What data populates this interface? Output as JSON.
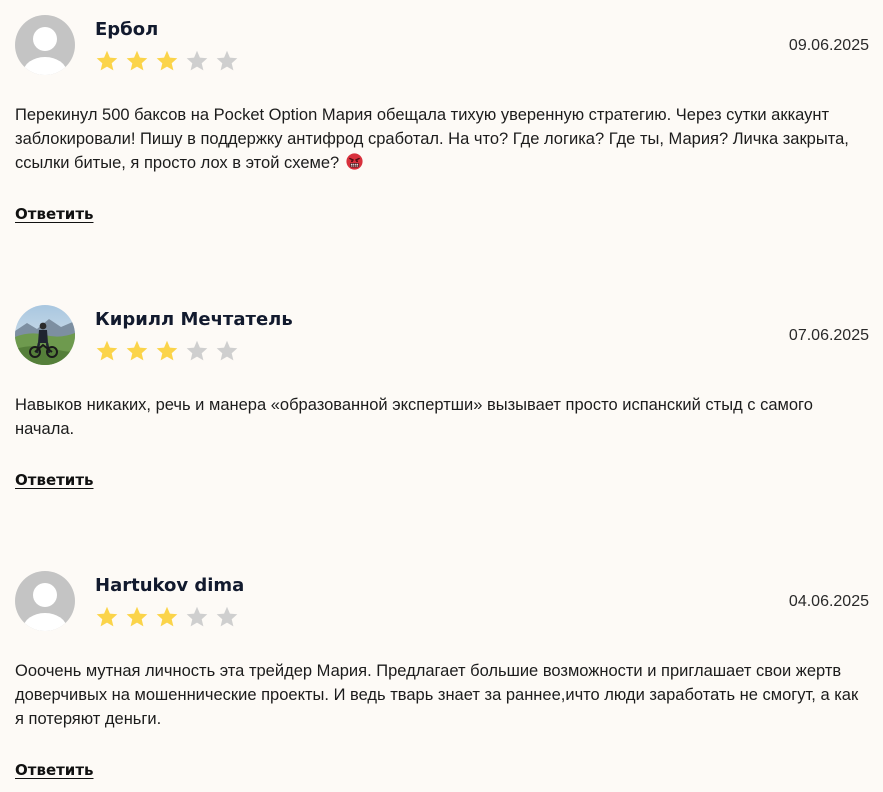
{
  "reviews": [
    {
      "author": "Ербол",
      "rating": 3,
      "max_rating": 5,
      "date": "09.06.2025",
      "text": "Перекинул 500 баксов на Pocket Option Мария обещала тихую уверенную стратегию. Через сутки аккаунт заблокировали! Пишу в поддержку антифрод сработал. На что? Где логика? Где ты, Мария? Личка закрыта, ссылки битые, я просто лох в этой схеме?",
      "emoji": "angry-face-icon",
      "avatar": "default-avatar-icon",
      "reply_label": "Ответить"
    },
    {
      "author": "Кирилл Мечтатель",
      "rating": 3,
      "max_rating": 5,
      "date": "07.06.2025",
      "text": "Навыков никаких, речь и манера «образованной экспертши» вызывает просто испанский стыд с самого начала.",
      "avatar": "user-photo-avatar",
      "reply_label": "Ответить"
    },
    {
      "author": "Hartukov dima",
      "rating": 3,
      "max_rating": 5,
      "date": "04.06.2025",
      "text": "Ооочень мутная личность эта трейдер Мария. Предлагает большие возможности и приглашает свои жертв доверчивых на мошеннические проекты. И ведь тварь знает за раннее,ичто люди заработать не смогут, а как я потеряют деньги.",
      "avatar": "default-avatar-icon",
      "reply_label": "Ответить"
    }
  ],
  "colors": {
    "background": "#fdfaf6",
    "star_filled": "#fbd44a",
    "star_empty": "#cfcfcf",
    "avatar_bg": "#c4c4c4"
  }
}
